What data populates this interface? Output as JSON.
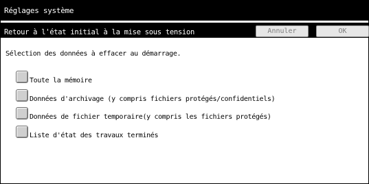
{
  "window": {
    "title": "Réglages système"
  },
  "subheader": {
    "title": "Retour à l'état initial à la mise sous tension",
    "cancel_label": "Annuler",
    "ok_label": "OK"
  },
  "main": {
    "instruction": "Sélection des données à effacer au démarrage.",
    "options": [
      {
        "label": "Toute la mémoire",
        "checked": false
      },
      {
        "label": "Données d'archivage (y compris fichiers protégés/confidentiels)",
        "checked": false
      },
      {
        "label": "Données de fichier temporaire(y compris les fichiers protégés)",
        "checked": false
      },
      {
        "label": "Liste d'état des travaux terminés",
        "checked": false
      }
    ]
  }
}
